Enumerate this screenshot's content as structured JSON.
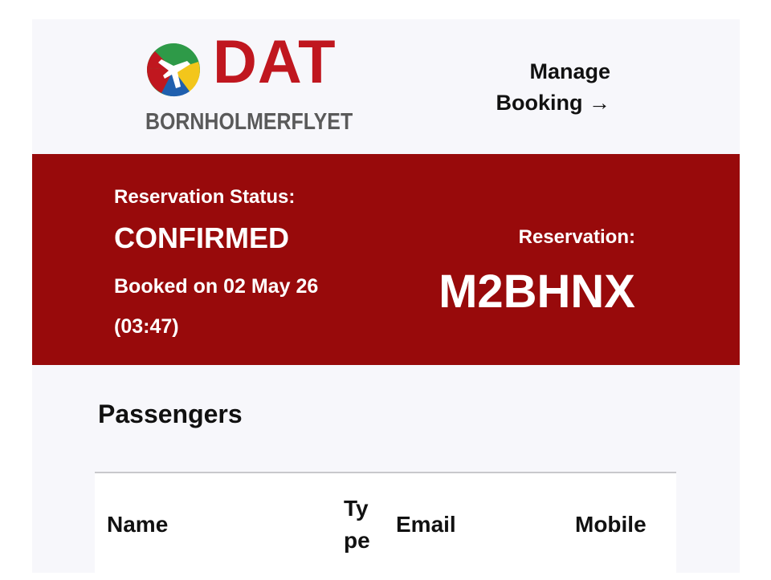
{
  "brand": {
    "logo_text": "DAT",
    "logo_subtitle": "BORNHOLMERFLYET",
    "colors": {
      "red": "#c0171f",
      "green": "#2e9a48",
      "blue": "#1f5fae",
      "yellow": "#f3c61b",
      "banner": "#980a0b"
    }
  },
  "header": {
    "manage_booking_line1": "Manage",
    "manage_booking_line2": "Booking",
    "manage_booking_arrow": "→"
  },
  "reservation": {
    "status_label": "Reservation Status:",
    "status_value": "CONFIRMED",
    "booked_on": "Booked on 02 May 26 (03:47)",
    "code_label": "Reservation:",
    "code": "M2BHNX"
  },
  "passengers": {
    "title": "Passengers",
    "columns": {
      "name": "Name",
      "type_line1": "Ty",
      "type_line2": "pe",
      "email": "Email",
      "mobile": "Mobile"
    }
  }
}
